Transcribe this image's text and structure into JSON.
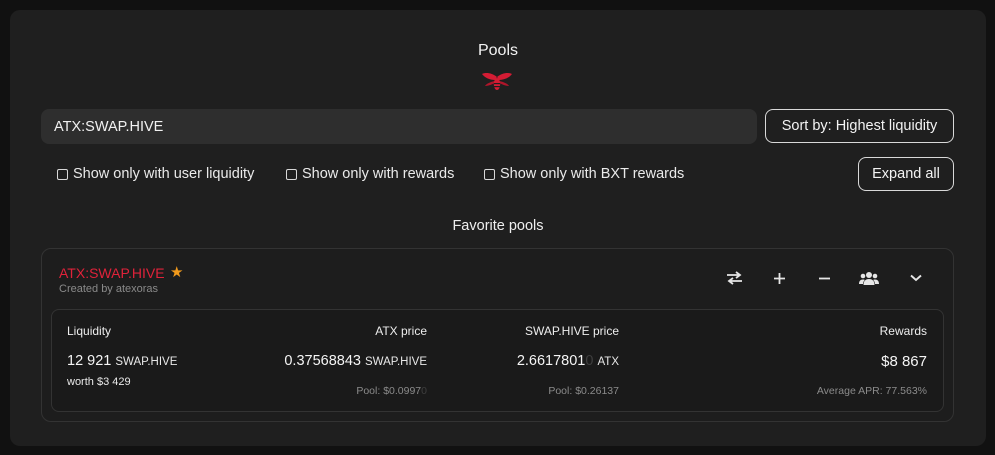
{
  "page": {
    "title": "Pools",
    "favorites_title": "Favorite pools"
  },
  "search": {
    "value": "ATX:SWAP.HIVE"
  },
  "sort_button": {
    "label": "Sort by: Highest liquidity"
  },
  "expand_button": {
    "label": "Expand all"
  },
  "filters": [
    {
      "label": "Show only with user liquidity",
      "checked": false
    },
    {
      "label": "Show only with rewards",
      "checked": false
    },
    {
      "label": "Show only with BXT rewards",
      "checked": false
    }
  ],
  "pool": {
    "name": "ATX:SWAP.HIVE",
    "created_by": "Created by atexoras",
    "favorite": true,
    "actions": [
      "swap-icon",
      "plus-icon",
      "minus-icon",
      "users-icon",
      "chevron-down-icon"
    ],
    "liquidity": {
      "label": "Liquidity",
      "amount": "12 921",
      "unit": "SWAP.HIVE",
      "worth": "worth $3 429"
    },
    "base_price": {
      "label": "ATX price",
      "amount": "0.37568843",
      "unit": "SWAP.HIVE",
      "pool_label": "Pool: $0.0997",
      "pool_faded": "0"
    },
    "quote_price": {
      "label": "SWAP.HIVE price",
      "amount": "2.6617801",
      "amount_faded": "0",
      "unit": "ATX",
      "pool_label": "Pool: $0.26137"
    },
    "rewards": {
      "label": "Rewards",
      "amount": "$8 867",
      "apr": "Average APR: 77.563%"
    }
  },
  "colors": {
    "accent": "#e0223a",
    "star": "#f29a1c",
    "panel": "#1f1f1f",
    "background": "#111111"
  }
}
